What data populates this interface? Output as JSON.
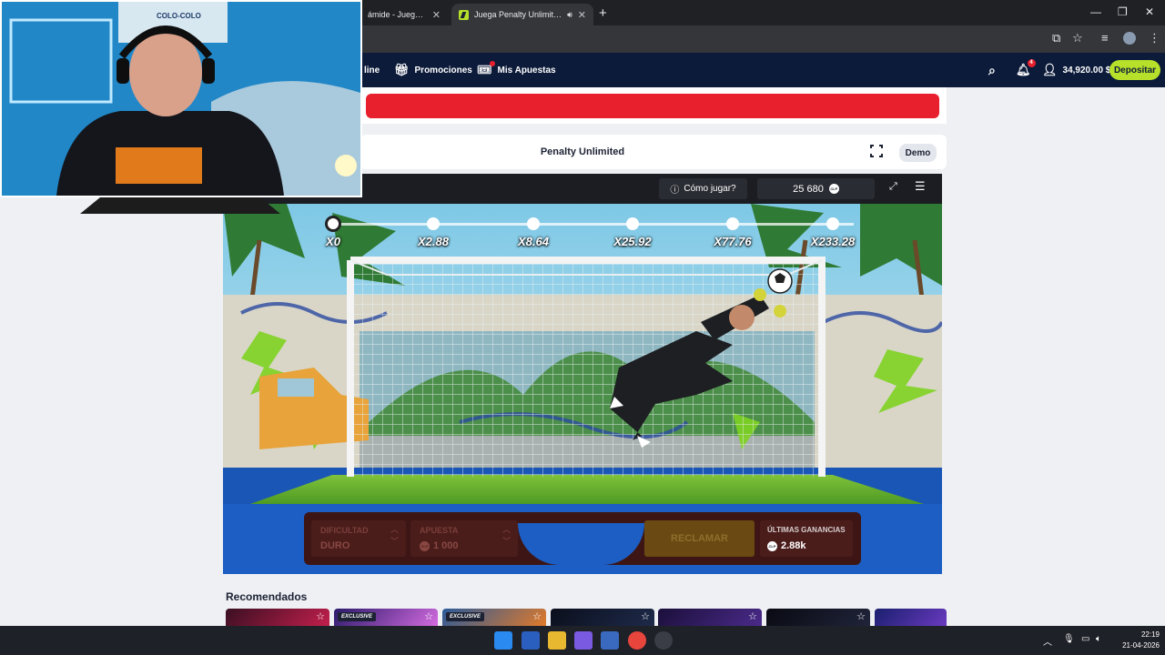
{
  "browser": {
    "tabs": [
      {
        "title": "ámide - Juega al ju",
        "close": "✕"
      },
      {
        "title": "Juega Penalty Unlimited de",
        "close": "✕",
        "audio": "speaker-icon"
      }
    ],
    "new_tab": "+",
    "window_controls": [
      "—",
      "❐",
      "✕"
    ]
  },
  "nav": {
    "partial_item": "line",
    "promociones": "Promociones",
    "mis_apuestas": "Mis Apuestas",
    "notifications": "4",
    "balance": "34,920.00 $",
    "deposit": "Depositar"
  },
  "game_header": {
    "title": "Penalty Unlimited",
    "demo": "Demo"
  },
  "game": {
    "how_to_play": "Cómo jugar?",
    "balance": "25 680",
    "currency": "CLP",
    "multipliers": [
      "X0",
      "X2.88",
      "X8.64",
      "X25.92",
      "X77.76",
      "X233.28"
    ],
    "current_step": 0,
    "difficulty_label": "DIFICULTAD",
    "difficulty_value": "DURO",
    "bet_label": "APUESTA",
    "bet_value": "1 000",
    "claim": "RECLAMAR",
    "last_win_label": "ÚLTIMAS GANANCIAS",
    "last_win_value": "2.88k"
  },
  "recommended": {
    "title": "Recomendados",
    "cards": [
      {
        "colors": [
          "#3a0f22",
          "#c21f4c"
        ],
        "badge": "",
        "star": "☆"
      },
      {
        "colors": [
          "#2b1a6b",
          "#d46be0"
        ],
        "badge": "EXCLUSIVE",
        "star": "☆"
      },
      {
        "colors": [
          "#2a5a9a",
          "#e07a2a"
        ],
        "badge": "EXCLUSIVE",
        "star": "☆"
      },
      {
        "colors": [
          "#0b0f1c",
          "#1e2a4a"
        ],
        "badge": "",
        "star": "☆"
      },
      {
        "colors": [
          "#1b0f3a",
          "#4a2a8a"
        ],
        "badge": "",
        "star": "☆"
      },
      {
        "colors": [
          "#090a12",
          "#20243a"
        ],
        "badge": "",
        "star": "☆"
      },
      {
        "colors": [
          "#1a1f6e",
          "#6a3ac0"
        ],
        "badge": "",
        "star": ""
      }
    ]
  },
  "taskbar": {
    "time": "22:19",
    "date": "21-04-2026"
  },
  "colors": {
    "brand_navy": "#0c1b3a",
    "accent_lime": "#b6e02a",
    "banner_red": "#e8202d"
  }
}
